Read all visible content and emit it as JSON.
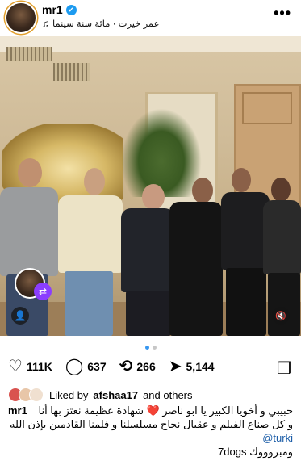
{
  "header": {
    "username": "mr1",
    "verified_mark": "✔",
    "music_note": "♫",
    "music_label": "عمر خيرت · مائة سنة سينما",
    "more_label": "•••"
  },
  "post": {
    "repost_icon": "⇄",
    "tag_icon": "👤",
    "mute_icon": "🔇"
  },
  "carousel": {
    "current": 1,
    "total": 2
  },
  "actions": {
    "like_icon": "♡",
    "likes": "111K",
    "comment_icon": "◯",
    "comments": "637",
    "repost_icon": "⟲",
    "reposts": "266",
    "share_icon": "➤",
    "shares": "5,144",
    "bookmark_icon": "❒"
  },
  "liked_by": {
    "prefix": "Liked by",
    "user": "afshaa17",
    "suffix": "and others"
  },
  "caption": {
    "username": "mr1",
    "line1": "حبيبي و أخويا الكبير يا ابو ناصر ❤️ شهادة عظيمة نعتز بها  أنا",
    "line2": "و كل صناع الفيلم و عقبال نجاح مسلسلنا و فلمنا القادمين بإذن الله",
    "mention": "@turki",
    "line4": "ومبروووك 7dogs"
  },
  "colors": {
    "verified": "#1d9bf0",
    "repost_badge": "#8b3dff",
    "active_dot": "#3897f0",
    "mention": "#1d5ea8"
  }
}
